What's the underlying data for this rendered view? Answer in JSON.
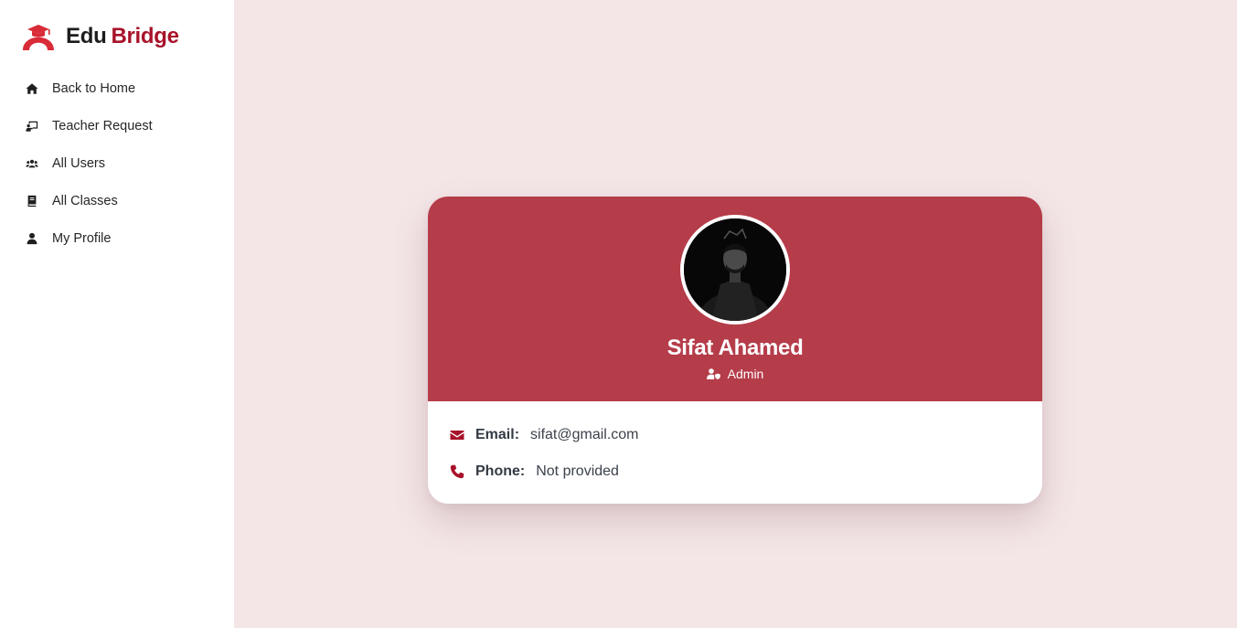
{
  "brand": {
    "part1": "Edu",
    "part2": "Bridge",
    "accent_color": "#a8122a"
  },
  "sidebar": {
    "items": [
      {
        "label": "Back to Home",
        "icon": "home-icon"
      },
      {
        "label": "Teacher Request",
        "icon": "chalkboard-teacher-icon"
      },
      {
        "label": "All Users",
        "icon": "users-icon"
      },
      {
        "label": "All Classes",
        "icon": "book-icon"
      },
      {
        "label": "My Profile",
        "icon": "user-icon"
      }
    ]
  },
  "profile": {
    "name": "Sifat Ahamed",
    "role": "Admin",
    "header_color": "#b53c49",
    "email_label": "Email:",
    "email_value": "sifat@gmail.com",
    "phone_label": "Phone:",
    "phone_value": "Not provided"
  }
}
